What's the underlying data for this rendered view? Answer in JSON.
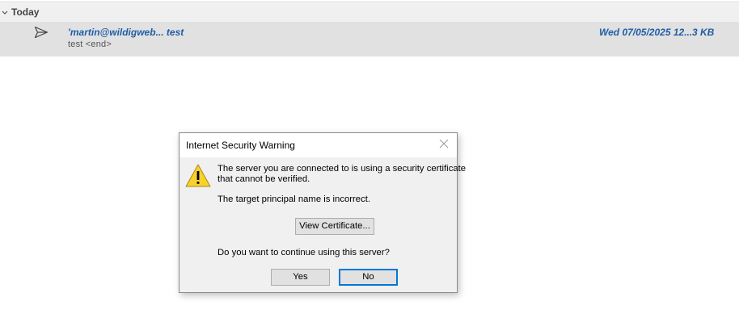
{
  "mail_list": {
    "group": {
      "label": "Today",
      "chevron_icon": "chevron-down-icon"
    },
    "rows": [
      {
        "icon": "sent-icon",
        "sender": "'martin@wildigweb... test",
        "preview": "test <end>",
        "date": "Wed 07/05/2025 12...",
        "size": "3 KB"
      }
    ]
  },
  "dialog": {
    "title": "Internet Security Warning",
    "icon": "warning-icon",
    "message_line1": "The server you are connected to is using a security certificate",
    "message_line2": "that cannot be verified.",
    "message_detail": "The target principal name is incorrect.",
    "view_certificate_label": "View Certificate...",
    "question": "Do you want to continue using this server?",
    "yes_label": "Yes",
    "no_label": "No"
  },
  "colors": {
    "accent": "#1f5da8",
    "focus_border": "#0078d7",
    "row_selected": "#e1e1e1",
    "warning_yellow": "#f8d22a"
  }
}
